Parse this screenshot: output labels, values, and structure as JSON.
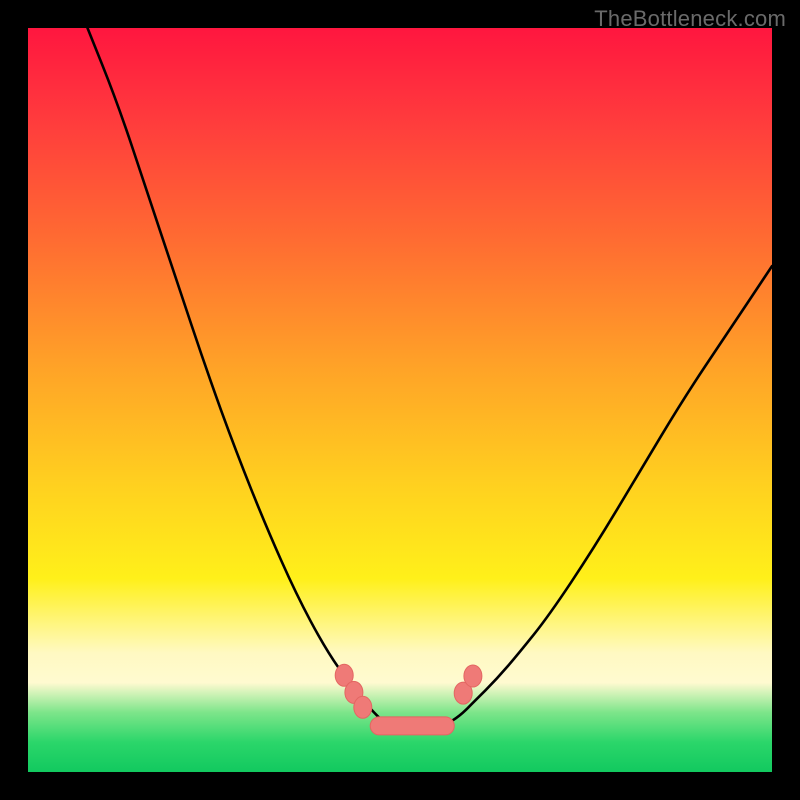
{
  "watermark": {
    "text": "TheBottleneck.com"
  },
  "colors": {
    "background": "#000000",
    "curve_stroke": "#000000",
    "marker_fill": "#ef7a77",
    "marker_stroke": "#e36662"
  },
  "chart_data": {
    "type": "line",
    "title": "",
    "xlabel": "",
    "ylabel": "",
    "xlim": [
      0,
      100
    ],
    "ylim": [
      0,
      100
    ],
    "grid": false,
    "legend": false,
    "note": "Single V-shaped curve over a vertical red→green gradient; no axes, ticks, or labels are visible. Values are read as percentage of plot width (x) and height from top (y=0 at top).",
    "series": [
      {
        "name": "curve",
        "x": [
          8,
          12,
          16,
          20,
          24,
          28,
          32,
          36,
          40,
          43.5,
          46,
          48,
          50,
          52,
          54,
          56,
          58,
          60,
          63,
          66,
          70,
          76,
          82,
          88,
          94,
          100
        ],
        "y": [
          0,
          10,
          22,
          34,
          46,
          57,
          67,
          76,
          83.5,
          88.5,
          91.5,
          93.5,
          94.5,
          94.7,
          94.5,
          93.7,
          92.5,
          90.5,
          87.5,
          84,
          79,
          70,
          60,
          50,
          41,
          32
        ]
      }
    ],
    "markers": {
      "note": "Pink rounded pill/circle markers near the valley of the curve.",
      "points_pct": [
        {
          "x": 42.5,
          "y": 87.0
        },
        {
          "x": 43.8,
          "y": 89.3
        },
        {
          "x": 45.0,
          "y": 91.3
        },
        {
          "x": 58.5,
          "y": 89.4
        },
        {
          "x": 59.8,
          "y": 87.1
        }
      ],
      "pill_pct": {
        "x1": 46.0,
        "x2": 57.3,
        "y": 93.8
      }
    }
  }
}
